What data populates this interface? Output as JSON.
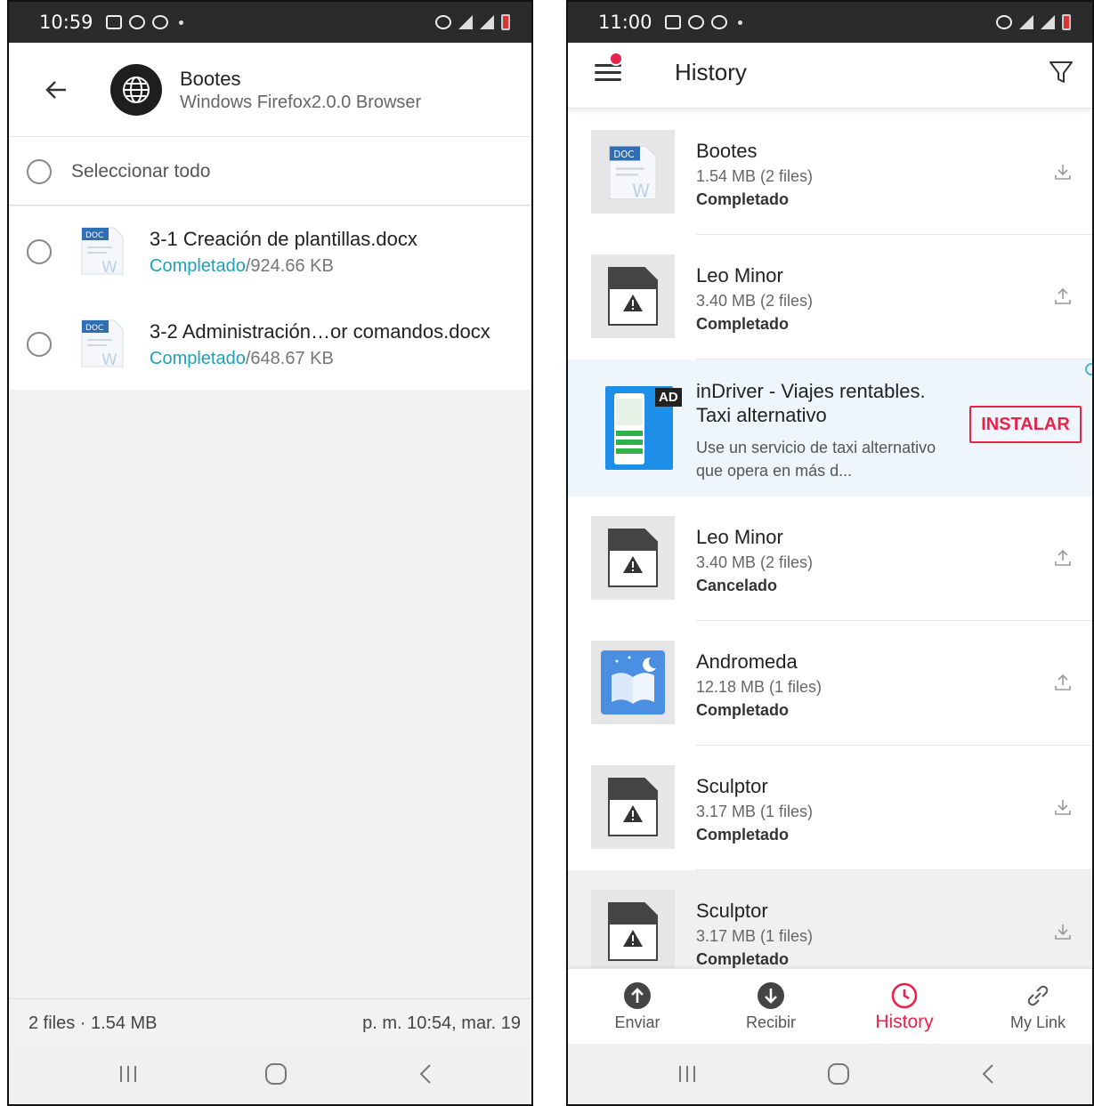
{
  "left": {
    "status_bar": {
      "time": "10:59"
    },
    "header": {
      "title": "Bootes",
      "subtitle": "Windows Firefox2.0.0 Browser"
    },
    "select_all": {
      "label": "Seleccionar todo"
    },
    "files": [
      {
        "name": "3-1 Creación de plantillas.docx",
        "status": "Completado",
        "size": "/924.66 KB",
        "icon": "doc-icon"
      },
      {
        "name": "3-2 Administración…or comandos.docx",
        "status": "Completado",
        "size": "/648.67 KB",
        "icon": "doc-icon"
      }
    ],
    "footer": {
      "count": "2 files · 1.54 MB",
      "date": "p. m. 10:54, mar. 19"
    }
  },
  "right": {
    "status_bar": {
      "time": "11:00"
    },
    "header": {
      "title": "History"
    },
    "items": [
      {
        "name": "Bootes",
        "size": "1.54 MB (2 files)",
        "status": "Completado",
        "thumb": "doc-icon",
        "action": "download-icon"
      },
      {
        "name": "Leo Minor",
        "size": "3.40 MB (2 files)",
        "status": "Completado",
        "thumb": "unknown-file-icon",
        "action": "upload-icon"
      },
      {
        "name": "Leo Minor",
        "size": "3.40 MB (2 files)",
        "status": "Cancelado",
        "thumb": "unknown-file-icon",
        "action": "upload-icon"
      },
      {
        "name": "Andromeda",
        "size": "12.18 MB (1 files)",
        "status": "Completado",
        "thumb": "book-app-icon",
        "action": "upload-icon"
      },
      {
        "name": "Sculptor",
        "size": "3.17 MB (1 files)",
        "status": "Completado",
        "thumb": "unknown-file-icon",
        "action": "download-icon"
      },
      {
        "name": "Sculptor",
        "size": "3.17 MB (1 files)",
        "status": "Completado",
        "thumb": "unknown-file-icon",
        "action": "download-icon"
      }
    ],
    "ad": {
      "badge": "AD",
      "title": "inDriver - Viajes rentables. Taxi alternativo",
      "description": "Use un servicio de taxi alternativo que opera en más d...",
      "cta": "INSTALAR"
    },
    "tabs": [
      {
        "label": "Enviar",
        "icon": "upload-arrow-icon",
        "active": false
      },
      {
        "label": "Recibir",
        "icon": "download-arrow-icon",
        "active": false
      },
      {
        "label": "History",
        "icon": "clock-icon",
        "active": true
      },
      {
        "label": "My Link",
        "icon": "link-icon",
        "active": false
      }
    ]
  },
  "colors": {
    "accent": "#e8234a",
    "status_teal": "#1aa3b8",
    "ad_bg": "#eef5fb"
  }
}
